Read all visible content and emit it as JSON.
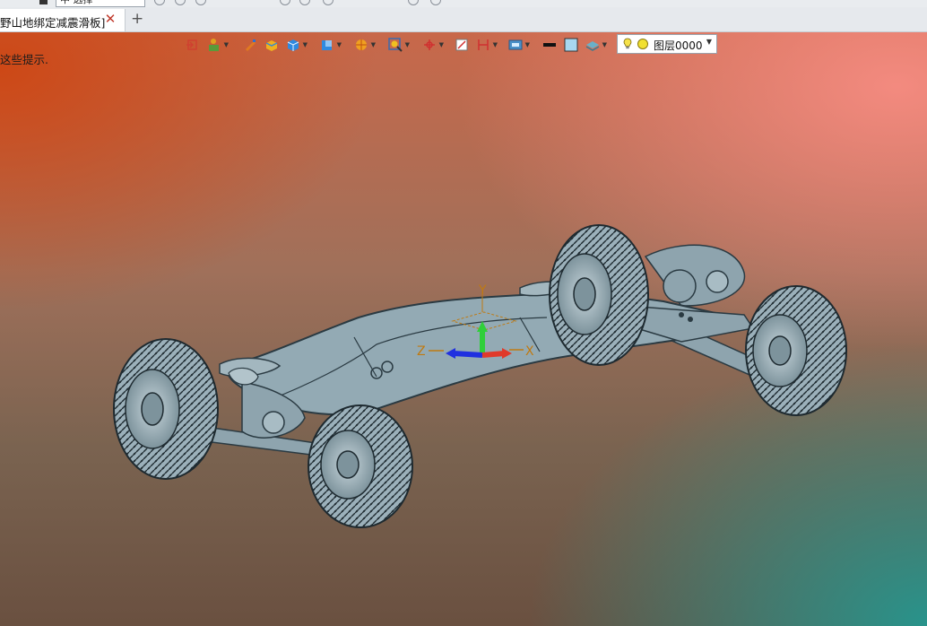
{
  "top_toolbar": {
    "select_value": "中  选择"
  },
  "tabs": [
    {
      "label": "野山地绑定减震滑板]",
      "active": true,
      "close_label": "✕"
    }
  ],
  "add_tab_label": "+",
  "viewport": {
    "hint": "这些提示.",
    "toolbar": {
      "tools": [
        "exit-sketch-icon",
        "shape-icon",
        "pen-icon",
        "solid-box-icon",
        "cube-icon",
        "view-cube-icon",
        "render-sphere-icon",
        "zoom-icon",
        "triad-icon",
        "section-icon",
        "ruler-icon",
        "display-icon",
        "line-color-icon",
        "fill-color-icon",
        "layer-style-icon"
      ],
      "layer": {
        "name": "图层0000"
      }
    },
    "axes": {
      "x": "X",
      "y": "Y",
      "z": "Z"
    },
    "colors": {
      "model": "#93aab4",
      "model_edge": "#2a3a42",
      "axis_x": "#e03a2a",
      "axis_y": "#2fcf3a",
      "axis_z": "#2030e0",
      "axis_label": "#c07a10"
    }
  }
}
